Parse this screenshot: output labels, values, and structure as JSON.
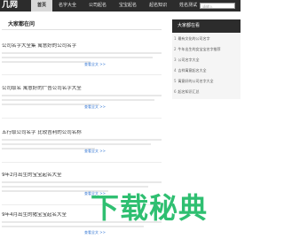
{
  "header": {
    "logo": "几网",
    "nav": [
      "首页",
      "名字大全",
      "公司起名",
      "宝宝起名",
      "起名知识",
      "姓名测试"
    ],
    "search_placeholder": "请输入"
  },
  "main": {
    "section_title": "大家都在问",
    "articles": [
      {
        "title": "公司名字大全集 寓意好的公司名字",
        "more": "查看全文 >>"
      },
      {
        "title": "公司取名 寓意好的广告公司名字大全",
        "more": "查看全文 >>"
      },
      {
        "title": "五行取公司名字 比较吉利的公司名称",
        "more": "查看全文 >>"
      },
      {
        "title": "9年2月出生的宝宝起名大全",
        "more": "查看全文 >>"
      },
      {
        "title": "9年4月出生的猪宝宝起名大全",
        "more": "查看全文 >>"
      }
    ]
  },
  "sidebar": {
    "title": "大家都在看",
    "items": [
      {
        "num": "1",
        "text": "最有文化的公司名字"
      },
      {
        "num": "2",
        "text": "牛年出生的女宝宝名字推荐"
      },
      {
        "num": "3",
        "text": "公司名字大全"
      },
      {
        "num": "4",
        "text": "吉祥寓意起名大全"
      },
      {
        "num": "5",
        "text": "寓意好的公司名字大全"
      },
      {
        "num": "6",
        "text": "起名知识汇总"
      }
    ]
  },
  "watermark": "下载秘典"
}
